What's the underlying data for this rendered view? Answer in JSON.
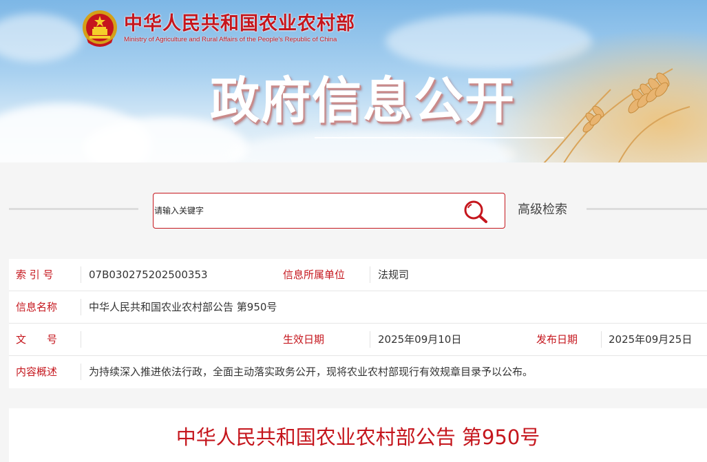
{
  "header": {
    "ministry_name_cn": "中华人民共和国农业农村部",
    "ministry_name_en": "Ministry of Agriculture and Rural Affairs of the People's Republic of China",
    "banner_title": "政府信息公开",
    "emblem_icon": "national-emblem-icon"
  },
  "search": {
    "placeholder": "请输入关键字",
    "button_icon": "search-icon",
    "advanced_label": "高级检索"
  },
  "info": {
    "index_label": "索 引 号",
    "index_value": "07B030275202500353",
    "dept_label": "信息所属单位",
    "dept_value": "法规司",
    "name_label": "信息名称",
    "name_value": "中华人民共和国农业农村部公告 第950号",
    "docno_label": "文　　号",
    "docno_value": "",
    "effective_label": "生效日期",
    "effective_value": "2025年09月10日",
    "publish_label": "发布日期",
    "publish_value": "2025年09月25日",
    "summary_label": "内容概述",
    "summary_value": "为持续深入推进依法行政，全面主动落实政务公开，现将农业农村部现行有效规章目录予以公布。"
  },
  "article": {
    "title": "中华人民共和国农业农村部公告 第950号"
  },
  "colors": {
    "brand_red": "#c5161d",
    "label_red": "#c5161d",
    "text": "#333333"
  }
}
